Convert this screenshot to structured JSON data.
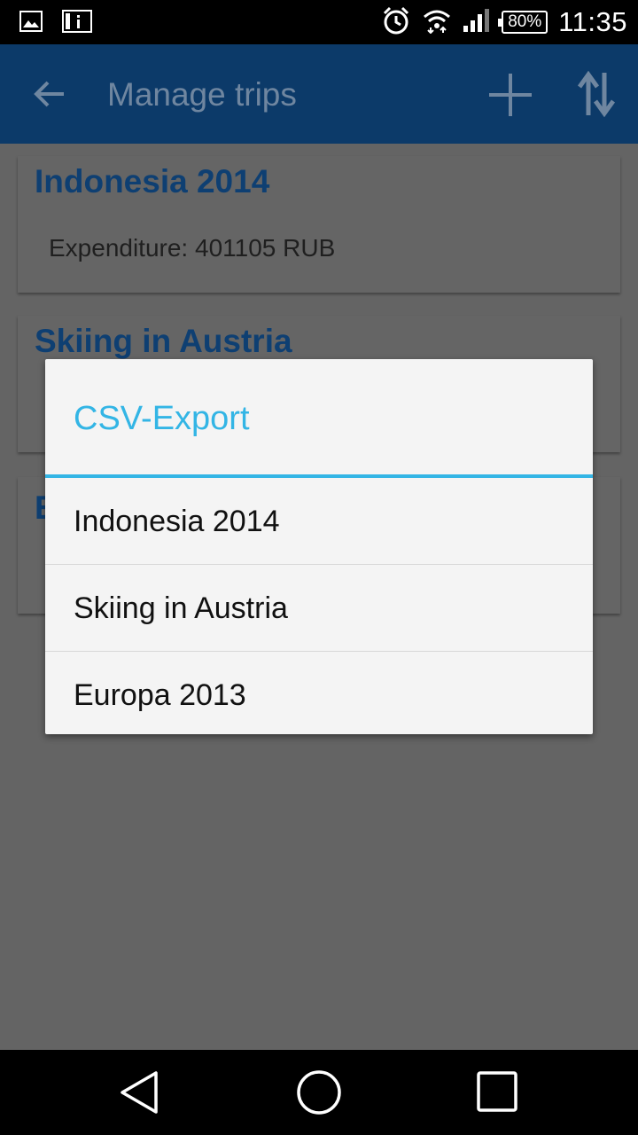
{
  "status_bar": {
    "time": "11:35",
    "battery": "80%",
    "icons": [
      "image-notification-icon",
      "info-notification-icon",
      "alarm-icon",
      "wifi-icon",
      "signal-icon",
      "battery-icon"
    ]
  },
  "app_bar": {
    "title": "Manage trips",
    "back_icon": "arrow-back-icon",
    "add_icon": "plus-icon",
    "sort_icon": "sort-arrows-icon",
    "color": "#0c3a69"
  },
  "trips": [
    {
      "name": "Indonesia 2014",
      "expenditure": "Expenditure: 401105 RUB"
    },
    {
      "name": "Skiing in Austria"
    },
    {
      "name": "E"
    }
  ],
  "dialog": {
    "title": "CSV-Export",
    "accent_color": "#33b5e5",
    "items": [
      {
        "label": "Indonesia 2014"
      },
      {
        "label": "Skiing in Austria"
      },
      {
        "label": "Europa 2013"
      }
    ]
  },
  "nav_bar": {
    "icons": [
      "back-triangle-icon",
      "home-circle-icon",
      "recents-square-icon"
    ]
  }
}
